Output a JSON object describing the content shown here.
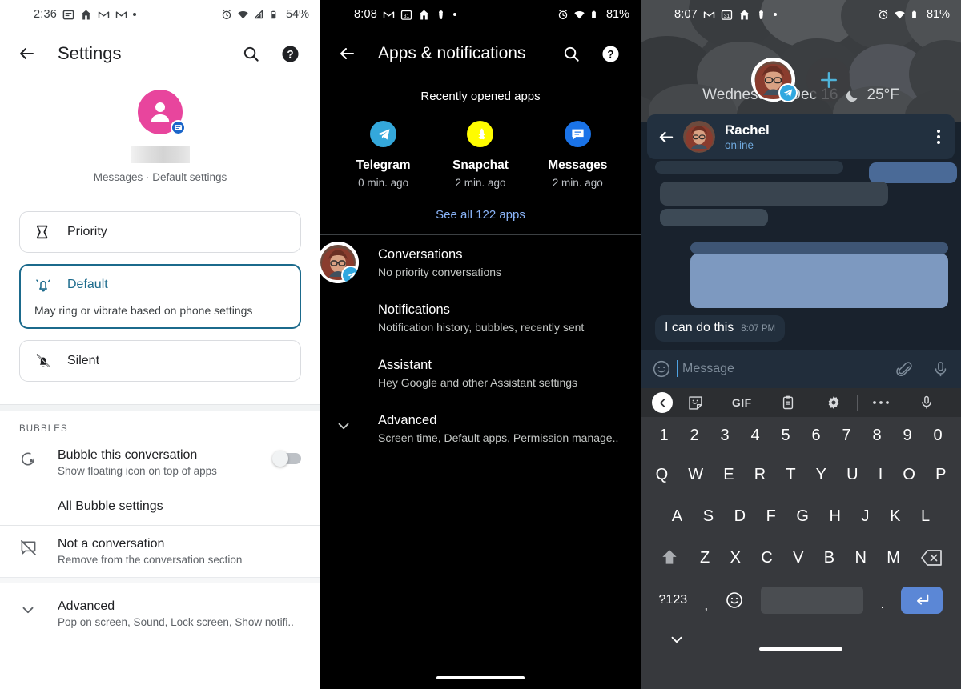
{
  "panels": {
    "left": {
      "statusbar": {
        "time": "2:36",
        "battery": "54%",
        "icons": [
          "message-icon",
          "home-icon",
          "gmail-icon",
          "gmail-icon",
          "dot-icon"
        ],
        "right_icons": [
          "alarm-icon",
          "wifi-icon",
          "signal-icon",
          "battery-icon"
        ]
      },
      "appbar": {
        "title": "Settings",
        "back": "back-arrow-icon",
        "search": "search-icon",
        "help": "help-icon"
      },
      "profile": {
        "subtitle": "Messages · Default settings",
        "avatar": "person-avatar-icon",
        "badge": "messages-badge-icon"
      },
      "importance": [
        {
          "label": "Priority",
          "icon": "priority-flag-icon",
          "selected": false,
          "desc": ""
        },
        {
          "label": "Default",
          "icon": "bell-ring-icon",
          "selected": true,
          "desc": "May ring or vibrate based on phone settings"
        },
        {
          "label": "Silent",
          "icon": "bell-off-icon",
          "selected": false,
          "desc": ""
        }
      ],
      "bubbles_header": "BUBBLES",
      "rows": [
        {
          "title": "Bubble this conversation",
          "sub": "Show floating icon on top of apps",
          "icon": "bubble-icon",
          "toggle": "off"
        },
        {
          "title": "All Bubble settings",
          "sub": "",
          "icon": "",
          "toggle": ""
        },
        {
          "title": "Not a conversation",
          "sub": "Remove from the conversation section",
          "icon": "not-conversation-icon",
          "toggle": ""
        },
        {
          "title": "Advanced",
          "sub": "Pop on screen, Sound, Lock screen, Show notifi..",
          "icon": "chevron-down-icon",
          "toggle": ""
        }
      ]
    },
    "middle": {
      "statusbar": {
        "time": "8:08",
        "battery": "81%",
        "icons": [
          "gmail-icon",
          "calendar-31-icon",
          "home-icon",
          "person-icon",
          "dot-icon"
        ],
        "right_icons": [
          "alarm-icon",
          "wifi-icon",
          "battery-icon"
        ]
      },
      "appbar": {
        "title": "Apps & notifications",
        "back": "back-arrow-icon",
        "search": "search-icon",
        "help": "help-icon"
      },
      "recent_header": "Recently opened apps",
      "recent_apps": [
        {
          "name": "Telegram",
          "ago": "0 min. ago",
          "icon": "telegram-icon",
          "color": "#34a8db"
        },
        {
          "name": "Snapchat",
          "ago": "2 min. ago",
          "icon": "snapchat-icon",
          "color": "#fffc00"
        },
        {
          "name": "Messages",
          "ago": "2 min. ago",
          "icon": "messages-icon",
          "color": "#1a73e8"
        }
      ],
      "see_all": "See all 122 apps",
      "rows": [
        {
          "title": "Conversations",
          "sub": "No priority conversations"
        },
        {
          "title": "Notifications",
          "sub": "Notification history, bubbles, recently sent"
        },
        {
          "title": "Assistant",
          "sub": "Hey Google and other Assistant settings"
        },
        {
          "title": "Advanced",
          "sub": "Screen time, Default apps, Permission manage.."
        }
      ]
    },
    "right": {
      "statusbar": {
        "time": "8:07",
        "battery": "81%",
        "icons": [
          "gmail-icon",
          "calendar-31-icon",
          "home-icon",
          "person-icon",
          "dot-icon"
        ],
        "right_icons": [
          "alarm-icon",
          "wifi-icon",
          "battery-icon"
        ]
      },
      "weather": {
        "date": "Wednesday, Dec 16",
        "temp": "25°F",
        "icon": "moon-icon"
      },
      "plus_button": "add-bubble-icon",
      "chat_header": {
        "name": "Rachel",
        "status": "online",
        "back": "back-arrow-icon",
        "menu": "kebab-menu-icon"
      },
      "message": {
        "text": "I can do this",
        "time": "8:07 PM"
      },
      "composer": {
        "placeholder": "Message",
        "emoji": "emoji-icon",
        "attach": "attachment-icon",
        "mic": "microphone-icon"
      },
      "keyboard": {
        "toolbar": [
          "collapse-icon",
          "sticker-icon",
          "GIF",
          "clipboard-icon",
          "settings-gear-icon",
          "more-icon",
          "microphone-icon"
        ],
        "gif_label": "GIF",
        "row_numbers": [
          "1",
          "2",
          "3",
          "4",
          "5",
          "6",
          "7",
          "8",
          "9",
          "0"
        ],
        "row1": [
          "Q",
          "W",
          "E",
          "R",
          "T",
          "Y",
          "U",
          "I",
          "O",
          "P"
        ],
        "row2": [
          "A",
          "S",
          "D",
          "F",
          "G",
          "H",
          "J",
          "K",
          "L"
        ],
        "row3": [
          "Z",
          "X",
          "C",
          "V",
          "B",
          "N",
          "M"
        ],
        "shift": "shift-icon",
        "backspace": "backspace-icon",
        "symbols": "?123",
        "comma": ",",
        "emoji": "emoji-key-icon",
        "period": ".",
        "enter": "enter-icon",
        "hide": "chevron-down-icon"
      }
    }
  },
  "colors": {
    "accent_blue": "#8ab4f8",
    "telegram_blue": "#34a8db",
    "selected_border": "#1b6a8c",
    "pink_avatar": "#e8459d"
  }
}
